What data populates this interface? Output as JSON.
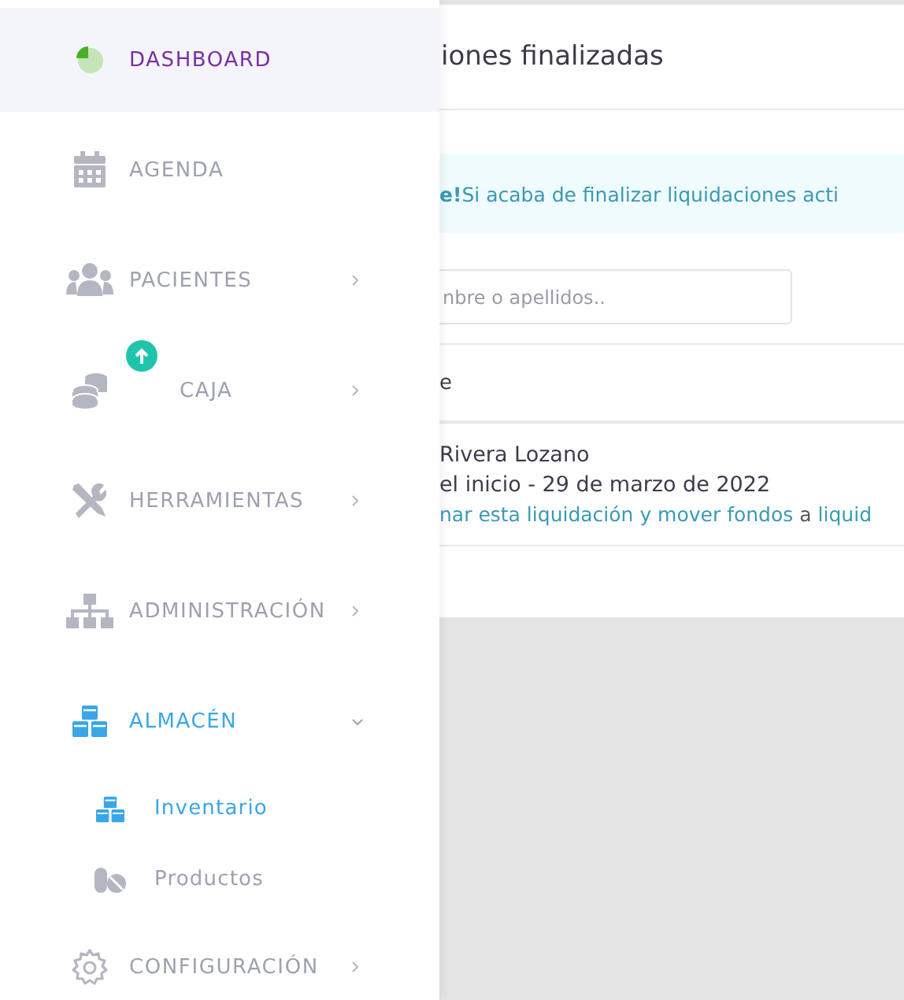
{
  "sidebar": {
    "items": [
      {
        "label": "DASHBOARD",
        "selected": true,
        "active": false
      },
      {
        "label": "AGENDA",
        "selected": false,
        "active": false
      },
      {
        "label": "PACIENTES",
        "selected": false,
        "active": false,
        "expanded": false
      },
      {
        "label": "CAJA",
        "selected": false,
        "active": false,
        "expanded": false,
        "notification": true
      },
      {
        "label": "HERRAMIENTAS",
        "selected": false,
        "active": false,
        "expanded": false
      },
      {
        "label": "ADMINISTRACIÓN",
        "selected": false,
        "active": false,
        "expanded": false
      },
      {
        "label": "ALMACÉN",
        "selected": false,
        "active": true,
        "expanded": true,
        "children": [
          {
            "label": "Inventario",
            "selected": true
          },
          {
            "label": "Productos",
            "selected": false
          }
        ]
      },
      {
        "label": "CONFIGURACIÓN",
        "selected": false,
        "active": false,
        "expanded": false
      }
    ]
  },
  "main": {
    "title": "iones finalizadas",
    "alert": {
      "strong": "e!",
      "text": "Si acaba de finalizar liquidaciones acti"
    },
    "search": {
      "placeholder": "nbre o apellidos.."
    },
    "table": {
      "column_1": "e",
      "rows": [
        {
          "name": "Rivera Lozano",
          "period": "el inicio - 29 de marzo de 2022",
          "link_1": "nar esta liquidación y mover fondos",
          "joiner": "a",
          "link_2": "liquid"
        }
      ]
    }
  }
}
